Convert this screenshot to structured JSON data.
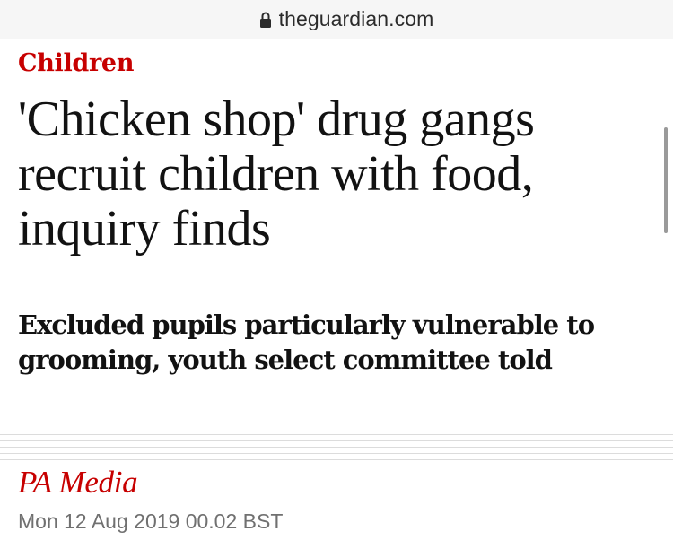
{
  "browser": {
    "url": "theguardian.com",
    "lock_icon": "lock-icon"
  },
  "article": {
    "section": "Children",
    "headline": "'Chicken shop' drug gangs recruit children with food, inquiry finds",
    "standfirst": "Excluded pupils particularly vulnerable to grooming, youth select committee told",
    "byline": "PA Media",
    "dateline": "Mon 12 Aug 2019 00.02 BST"
  },
  "colors": {
    "accent": "#c70000",
    "text": "#121212",
    "muted": "#707070",
    "url_bar": "#f6f6f6"
  }
}
